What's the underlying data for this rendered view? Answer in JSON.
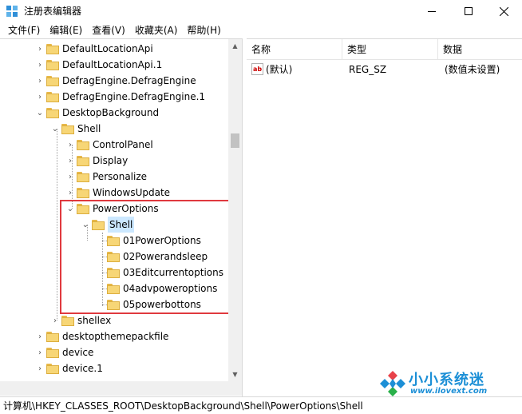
{
  "window": {
    "title": "注册表编辑器"
  },
  "menu": [
    "文件(F)",
    "编辑(E)",
    "查看(V)",
    "收藏夹(A)",
    "帮助(H)"
  ],
  "tree": {
    "nodes": [
      {
        "label": "DefaultLocationApi"
      },
      {
        "label": "DefaultLocationApi.1"
      },
      {
        "label": "DefragEngine.DefragEngine"
      },
      {
        "label": "DefragEngine.DefragEngine.1"
      },
      {
        "label": "DesktopBackground"
      },
      {
        "label": "Shell"
      },
      {
        "label": "ControlPanel"
      },
      {
        "label": "Display"
      },
      {
        "label": "Personalize"
      },
      {
        "label": "WindowsUpdate"
      },
      {
        "label": "PowerOptions"
      },
      {
        "label": "Shell"
      },
      {
        "label": "01PowerOptions"
      },
      {
        "label": "02Powerandsleep"
      },
      {
        "label": "03Editcurrentoptions"
      },
      {
        "label": "04advpoweroptions"
      },
      {
        "label": "05powerbottons"
      },
      {
        "label": "shellex"
      },
      {
        "label": "desktopthemepackfile"
      },
      {
        "label": "device"
      },
      {
        "label": "device.1"
      }
    ]
  },
  "list": {
    "columns": [
      "名称",
      "类型",
      "数据"
    ],
    "rows": [
      {
        "name": "(默认)",
        "type": "REG_SZ",
        "data": "(数值未设置)"
      }
    ]
  },
  "statusbar": {
    "path": "计算机\\HKEY_CLASSES_ROOT\\DesktopBackground\\Shell\\PowerOptions\\Shell"
  },
  "watermark": {
    "text": "小小系统迷",
    "url": "www.ilovext.com"
  },
  "colors": {
    "selection": "#cce8ff",
    "highlight_border": "#e0393e",
    "folder": "#f7d676",
    "watermark": "#1c8fd6"
  }
}
